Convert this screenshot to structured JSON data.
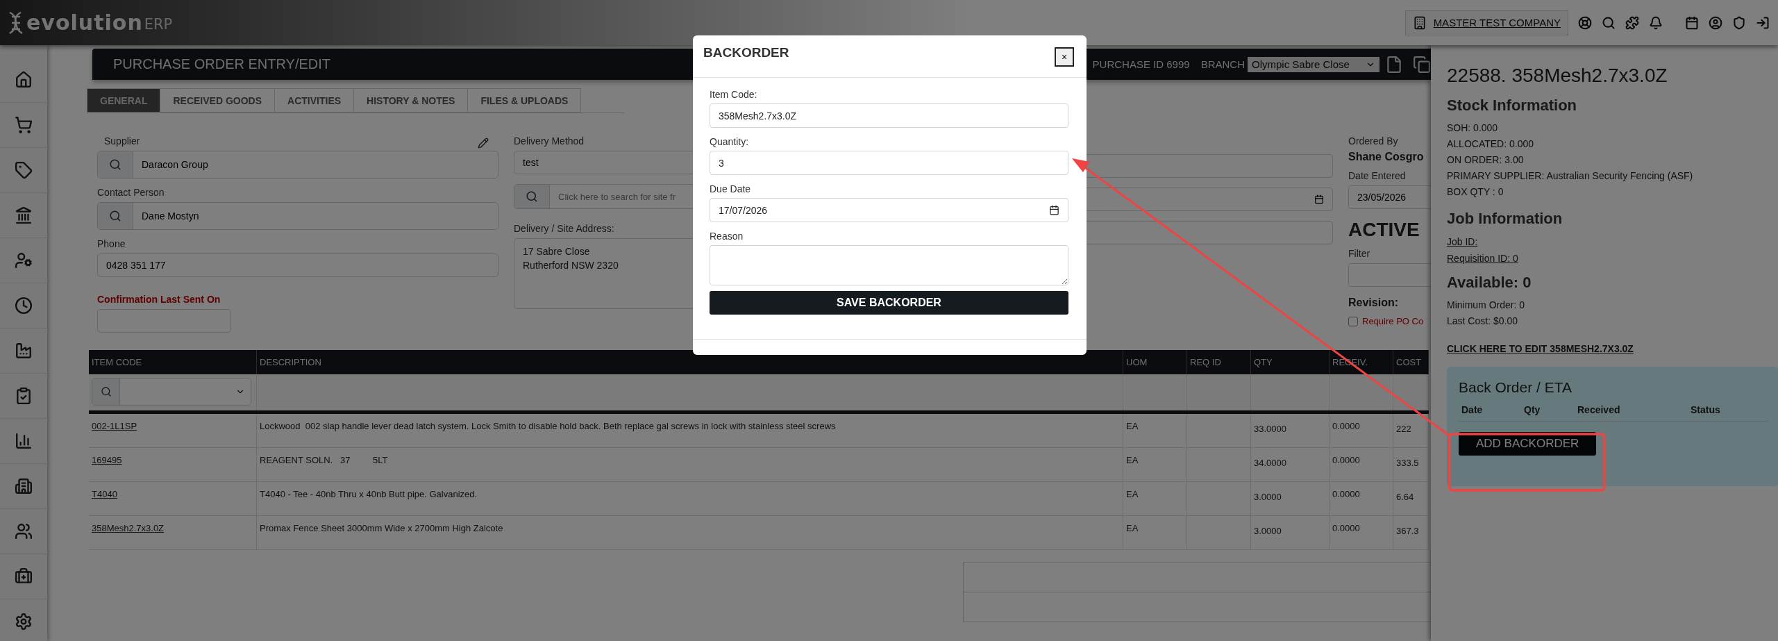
{
  "topbar": {
    "logo": "evolution",
    "logo_suffix": "ERP",
    "company": "MASTER TEST COMPANY"
  },
  "header": {
    "title": "PURCHASE ORDER ENTRY/EDIT",
    "purchase_id": "PURCHASE ID 6999",
    "branch_label": "BRANCH",
    "branch": "Olympic Sabre Close"
  },
  "tabs": [
    {
      "label": "GENERAL",
      "selected": true
    },
    {
      "label": "RECEIVED GOODS",
      "selected": false
    },
    {
      "label": "ACTIVITIES",
      "selected": false
    },
    {
      "label": "HISTORY & NOTES",
      "selected": false
    },
    {
      "label": "FILES & UPLOADS",
      "selected": false
    }
  ],
  "form": {
    "supplier": {
      "label": "Supplier",
      "value": "Daracon Group"
    },
    "contact": {
      "label": "Contact Person",
      "value": "Dane Mostyn"
    },
    "phone": {
      "label": "Phone",
      "value": "0428 351 177"
    },
    "confirmation": {
      "label": "Confirmation Last Sent On"
    },
    "delivery_method": {
      "label": "Delivery Method",
      "value": "test"
    },
    "site_search": {
      "placeholder": "Click here to search for site fr"
    },
    "address": {
      "label": "Delivery / Site Address:",
      "lines": [
        "17 Sabre Close",
        "Rutherford NSW 2320"
      ]
    },
    "ordered_by": {
      "label": "Ordered By",
      "value": "Shane Cosgro"
    },
    "date_entered": {
      "label": "Date Entered",
      "value": "23/05/2026"
    },
    "status": "ACTIVE",
    "filter": {
      "label": "Filter"
    },
    "revision": {
      "label": "Revision:"
    },
    "require_po": {
      "label": "Require PO Co",
      "checked": false
    }
  },
  "table": {
    "columns": [
      "ITEM CODE",
      "DESCRIPTION",
      "UOM",
      "REQ ID",
      "QTY",
      "RECEIV.",
      "COST"
    ],
    "rows": [
      {
        "item_code": "002-1L1SP",
        "description": "Lockwood  002 slap handle lever dead latch system. Lock Smith to disable hold back. Beth replace gal screws in lock with stainless steel screws",
        "uom": "EA",
        "qty": "33.0000",
        "received": "0.0000",
        "cost": "222"
      },
      {
        "item_code": "169495",
        "description": "REAGENT SOLN.   37         5LT",
        "uom": "EA",
        "qty": "34.0000",
        "received": "0.0000",
        "cost": "333.5"
      },
      {
        "item_code": "T4040",
        "description": "T4040 - Tee - 40nb Thru x 40nb Butt pipe. Galvanized.",
        "uom": "EA",
        "qty": "3.0000",
        "received": "0.0000",
        "cost": "6.64"
      },
      {
        "item_code": "358Mesh2.7x3.0Z",
        "description": "Promax Fence Sheet 3000mm Wide x 2700mm High Zalcote",
        "uom": "EA",
        "qty": "3.0000",
        "received": "0.0000",
        "cost": "367.3"
      }
    ]
  },
  "item_panel": {
    "title": "22588. 358Mesh2.7x3.0Z",
    "stock_heading": "Stock Information",
    "stock_lines": [
      "SOH: 0.000",
      "ALLOCATED: 0.000",
      "ON ORDER: 3.00",
      "PRIMARY SUPPLIER: Australian Security Fencing (ASF)",
      "BOX QTY : 0"
    ],
    "job_heading": "Job Information",
    "job_links": [
      "Job ID:",
      "Requisition ID: 0"
    ],
    "available": "Available: 0",
    "other_lines": [
      "Minimum Order: 0",
      "Last Cost: $0.00"
    ],
    "edit_link": "CLICK HERE TO EDIT 358MESH2.7X3.0Z",
    "backorder": {
      "title": "Back Order / ETA",
      "columns": [
        "Date",
        "Qty",
        "Received",
        "Status"
      ],
      "add_button": "ADD BACKORDER"
    }
  },
  "modal": {
    "title": "BACKORDER",
    "close": "×",
    "save": "SAVE BACKORDER",
    "fields": [
      {
        "kind": "text",
        "label": "Item Code:",
        "value": "358Mesh2.7x3.0Z"
      },
      {
        "kind": "text",
        "label": "Quantity:",
        "value": "3"
      },
      {
        "kind": "date",
        "label": "Due Date",
        "value": "17/07/2026"
      },
      {
        "kind": "textarea",
        "label": "Reason"
      }
    ]
  }
}
